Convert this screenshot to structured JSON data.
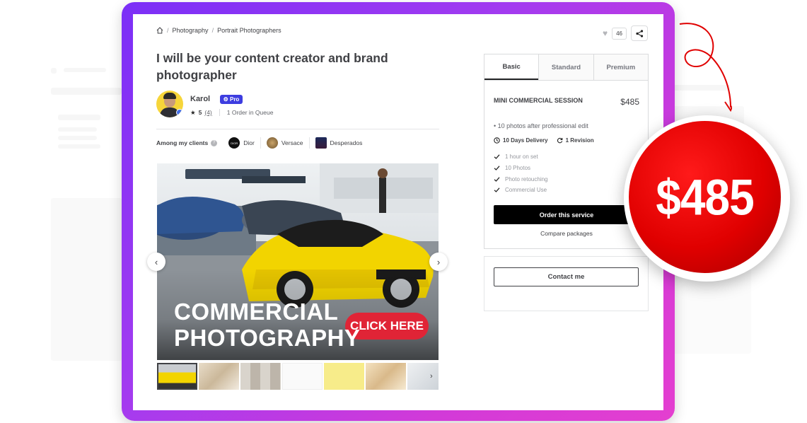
{
  "breadcrumb": {
    "items": [
      "Photography",
      "Portrait Photographers"
    ],
    "separator": "/"
  },
  "actions": {
    "like_count": "46"
  },
  "gig": {
    "title": "I will be your content creator and brand photographer"
  },
  "seller": {
    "name": "Karol",
    "badge": "Pro",
    "rating": "5",
    "rating_count": "(4)",
    "queue": "1 Order in Queue"
  },
  "clients": {
    "label": "Among my clients",
    "items": [
      {
        "name": "Dior",
        "logo_text": "DIOR",
        "color": "#111111"
      },
      {
        "name": "Versace",
        "logo_text": "",
        "color": "#8a6b3f"
      },
      {
        "name": "Desperados",
        "logo_text": "",
        "color": "#1c2a5a"
      }
    ]
  },
  "gallery": {
    "headline_line1": "COMMERCIAL",
    "headline_line2": "PHOTOGRAPHY",
    "cta": "CLICK HERE",
    "thumb_count": 7
  },
  "package": {
    "tabs": [
      "Basic",
      "Standard",
      "Premium"
    ],
    "active_tab": "Basic",
    "name": "MINI COMMERCIAL SESSION",
    "price": "$485",
    "description": "• 10 photos after professional edit",
    "delivery": "10 Days Delivery",
    "revisions": "1 Revision",
    "features": [
      "1 hour on set",
      "10 Photos",
      "Photo retouching",
      "Commercial Use"
    ],
    "order_button": "Order this service",
    "compare_link": "Compare packages"
  },
  "contact": {
    "button": "Contact me"
  },
  "price_bubble": {
    "text": "$485",
    "color": "#e00000"
  },
  "colors": {
    "frame_start": "#7b2ff7",
    "frame_end": "#e43fd0",
    "pro_badge": "#3d3de0"
  }
}
